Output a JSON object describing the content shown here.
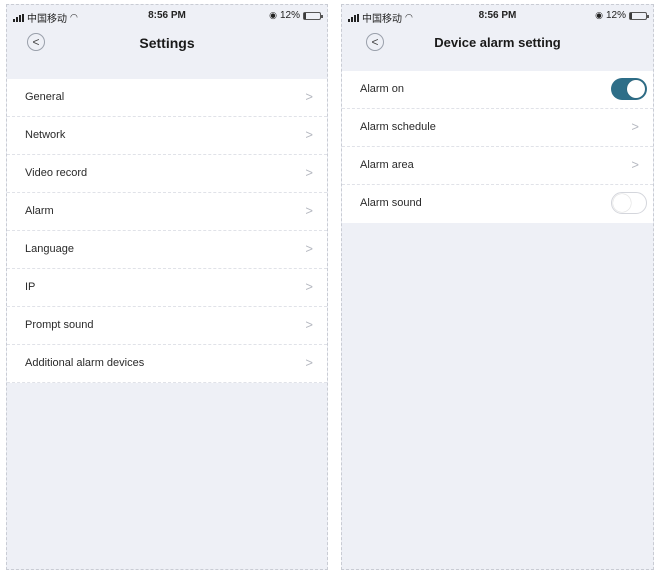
{
  "status_bar": {
    "carrier": "中国移动",
    "time": "8:56 PM",
    "battery_percent": "12%",
    "battery_level": 0.12
  },
  "settings_screen": {
    "title": "Settings",
    "back_icon": "chevron-left-icon",
    "items": [
      {
        "label": "General"
      },
      {
        "label": "Network"
      },
      {
        "label": "Video record"
      },
      {
        "label": "Alarm"
      },
      {
        "label": "Language"
      },
      {
        "label": "IP"
      },
      {
        "label": "Prompt sound"
      },
      {
        "label": "Additional alarm devices"
      }
    ]
  },
  "alarm_screen": {
    "title": "Device alarm setting",
    "back_icon": "chevron-left-icon",
    "items": [
      {
        "label": "Alarm on",
        "control": "toggle",
        "value": true
      },
      {
        "label": "Alarm schedule",
        "control": "chevron"
      },
      {
        "label": "Alarm area",
        "control": "chevron"
      },
      {
        "label": "Alarm sound",
        "control": "toggle",
        "value": false
      }
    ]
  },
  "colors": {
    "toggle_on": "#2e6e88",
    "background": "#eef0f6"
  },
  "glyphs": {
    "chevron": ">",
    "back": "<"
  }
}
